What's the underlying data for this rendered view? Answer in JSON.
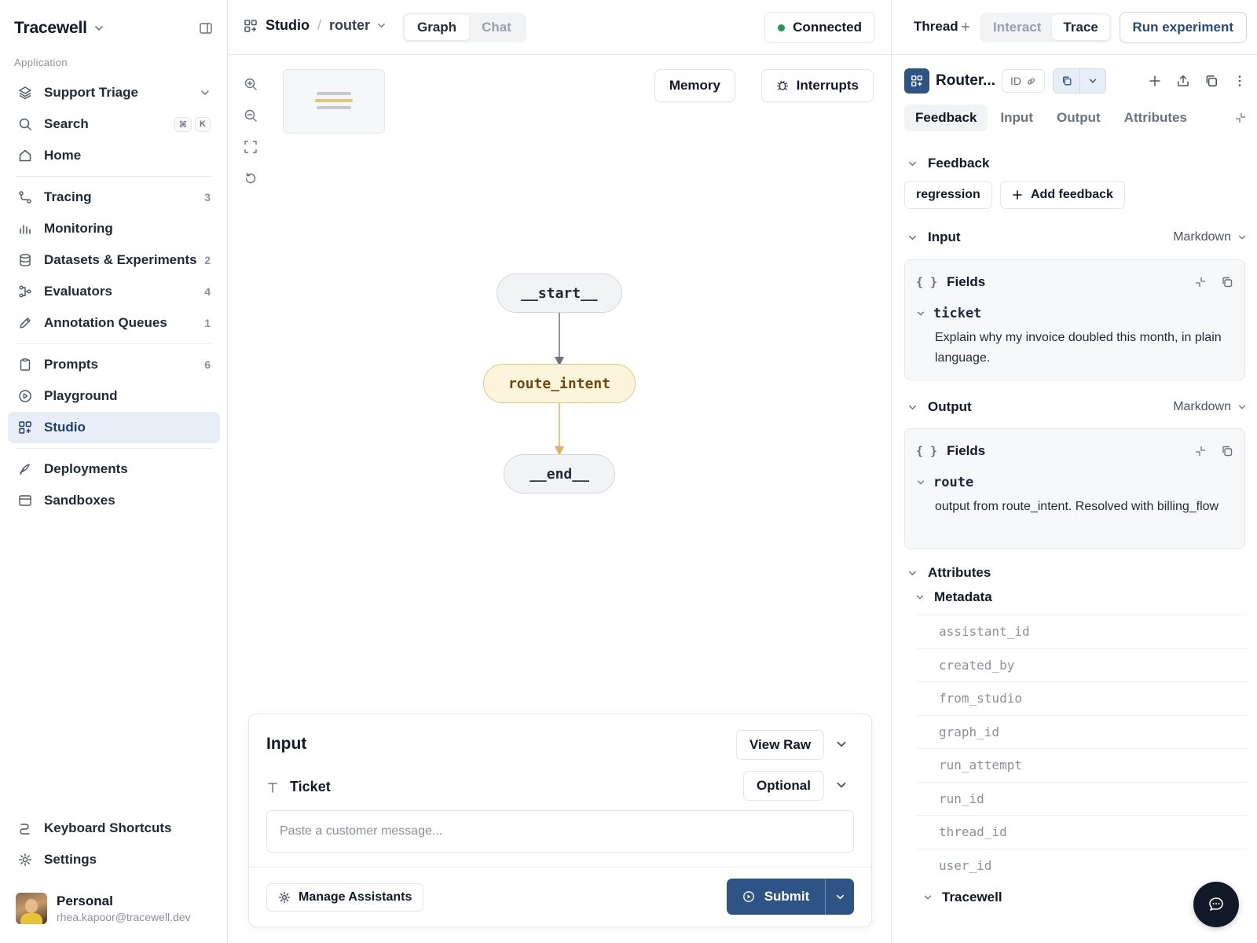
{
  "app": {
    "name": "Tracewell",
    "section_label": "Application",
    "project": "Support Triage"
  },
  "sidebar": {
    "search_label": "Search",
    "search_keys": [
      "⌘",
      "K"
    ],
    "home_label": "Home",
    "items": [
      {
        "label": "Tracing",
        "count": "3",
        "icon": "route-icon"
      },
      {
        "label": "Monitoring",
        "count": "",
        "icon": "bar-chart-icon"
      },
      {
        "label": "Datasets & Experiments",
        "count": "2",
        "icon": "database-icon"
      },
      {
        "label": "Evaluators",
        "count": "4",
        "icon": "evaluator-icon"
      },
      {
        "label": "Annotation Queues",
        "count": "1",
        "icon": "pencil-icon"
      }
    ],
    "items2": [
      {
        "label": "Prompts",
        "count": "6",
        "icon": "clipboard-icon"
      },
      {
        "label": "Playground",
        "count": "",
        "icon": "play-circle-icon"
      },
      {
        "label": "Studio",
        "count": "",
        "icon": "studio-grid-icon",
        "active": true
      }
    ],
    "items3": [
      {
        "label": "Deployments",
        "icon": "rocket-icon"
      },
      {
        "label": "Sandboxes",
        "icon": "window-icon"
      }
    ],
    "bottom": [
      {
        "label": "Keyboard Shortcuts",
        "icon": "shortcut-icon"
      },
      {
        "label": "Settings",
        "icon": "gear-icon"
      }
    ],
    "user": {
      "name": "Personal",
      "email": "rhea.kapoor@tracewell.dev"
    }
  },
  "center": {
    "breadcrumb": {
      "root": "Studio",
      "graph": "router"
    },
    "view_tabs": {
      "graph": "Graph",
      "chat": "Chat",
      "active": "Graph"
    },
    "status": "Connected",
    "buttons": {
      "memory": "Memory",
      "interrupts": "Interrupts"
    },
    "nodes": {
      "start": "__start__",
      "route": "route_intent",
      "end": "__end__"
    },
    "input_panel": {
      "title": "Input",
      "view_raw": "View Raw",
      "field_label": "Ticket",
      "optional": "Optional",
      "placeholder": "Paste a customer message...",
      "manage": "Manage Assistants",
      "submit": "Submit"
    }
  },
  "right": {
    "thread_label": "Thread",
    "mode_tabs": {
      "interact": "Interact",
      "trace": "Trace",
      "active": "Trace"
    },
    "run_experiment": "Run experiment",
    "run_title": "Router...",
    "id_label": "ID",
    "tabs": [
      "Feedback",
      "Input",
      "Output",
      "Attributes"
    ],
    "active_tab": "Feedback",
    "feedback": {
      "heading": "Feedback",
      "tag": "regression",
      "add": "Add feedback"
    },
    "input": {
      "heading": "Input",
      "format": "Markdown",
      "fields_label": "Fields",
      "key": "ticket",
      "value": "Explain why my invoice doubled this month, in plain language."
    },
    "output": {
      "heading": "Output",
      "format": "Markdown",
      "fields_label": "Fields",
      "key": "route",
      "value": "output from route_intent. Resolved with billing_flow"
    },
    "attributes": {
      "heading": "Attributes",
      "metadata_label": "Metadata",
      "metadata_keys": [
        "assistant_id",
        "created_by",
        "from_studio",
        "graph_id",
        "run_attempt",
        "run_id",
        "thread_id",
        "user_id"
      ],
      "tracewell_label": "Tracewell"
    }
  },
  "colors": {
    "accent": "#2d5484",
    "active_nav_bg": "#e8eef8",
    "node_highlight": "#fdf4dc",
    "connected": "#1f9a5b"
  }
}
